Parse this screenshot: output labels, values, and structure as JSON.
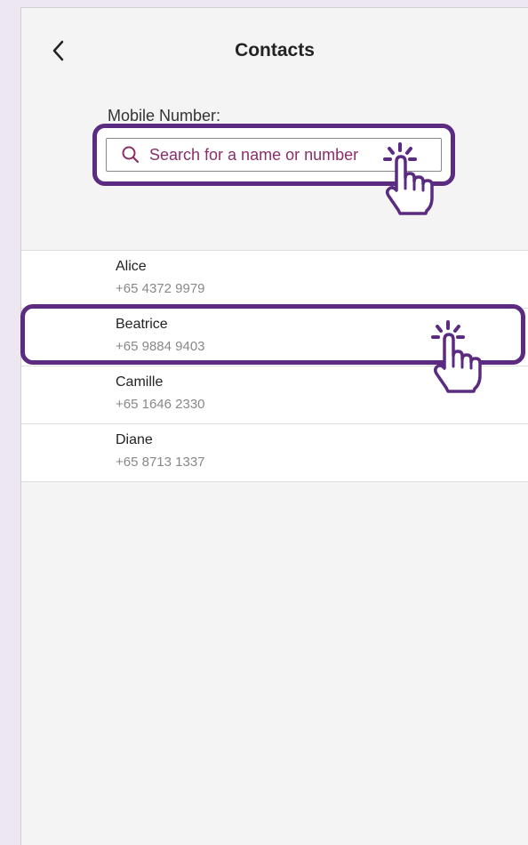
{
  "header": {
    "title": "Contacts"
  },
  "form": {
    "mobile_label": "Mobile Number:",
    "search_placeholder": "Search for a name or number"
  },
  "contacts": [
    {
      "name": "Alice",
      "phone": "+65 4372 9979"
    },
    {
      "name": "Beatrice",
      "phone": "+65 9884 9403"
    },
    {
      "name": "Camille",
      "phone": "+65 1646 2330"
    },
    {
      "name": "Diane",
      "phone": "+65 8713 1337"
    }
  ],
  "colors": {
    "highlight": "#5a2b80",
    "placeholder": "#8a2f6a",
    "background": "#ece7f1",
    "screen": "#f4f4f4"
  },
  "icons": {
    "back": "chevron-left-icon",
    "search": "search-icon",
    "tap": "tap-hand-icon"
  }
}
